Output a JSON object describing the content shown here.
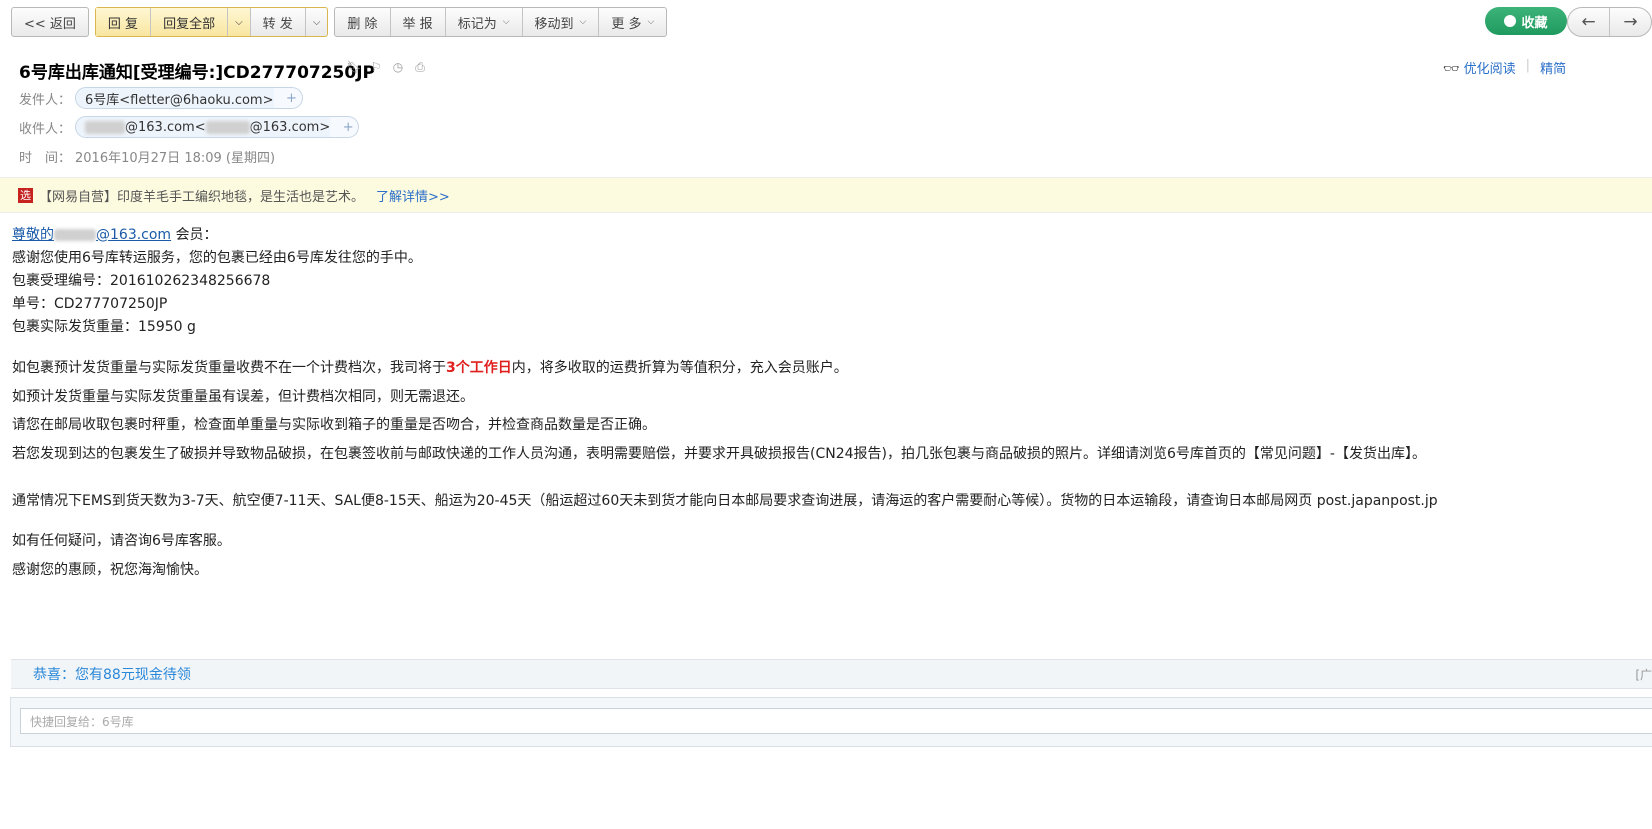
{
  "toolbar": {
    "back": "<< 返回",
    "reply": "回 复",
    "reply_all": "回复全部",
    "forward": "转 发",
    "delete": "删 除",
    "report": "举 报",
    "mark_as": "标记为",
    "move_to": "移动到",
    "more": "更 多"
  },
  "actions": {
    "favorite": "收藏"
  },
  "read_tools": {
    "optimize": "优化阅读",
    "simplified": "精简"
  },
  "mail": {
    "subject": "6号库出库通知[受理编号:]CD277707250JP",
    "from_label": "发件人：",
    "from_value": "6号库<fletter@6haoku.com>",
    "to_label": "收件人：",
    "to_domain1": "@163.com<",
    "to_domain2": "@163.com>",
    "time_label": "时　间：",
    "time_value": "2016年10月27日 18:09 (星期四)"
  },
  "ad": {
    "tag": "选",
    "text": "【网易自营】印度羊毛手工编织地毯，是生活也是艺术。",
    "link": "了解详情>>"
  },
  "body": {
    "greet_prefix": "尊敬的",
    "greet_domain": "@163.com",
    "greet_suffix": " 会员：",
    "line1": "感谢您使用6号库转运服务，您的包裹已经由6号库发往您的手中。",
    "line2": "包裹受理编号：201610262348256678",
    "line3": "单号：CD277707250JP",
    "line4": "包裹实际发货重量：15950 g",
    "p1_a": "如包裹预计发货重量与实际发货重量收费不在一个计费档次，我司将于",
    "p1_red": "3个工作日",
    "p1_b": "内，将多收取的运费折算为等值积分，充入会员账户。",
    "p2": "如预计发货重量与实际发货重量虽有误差，但计费档次相同，则无需退还。",
    "p3": "请您在邮局收取包裹时秤重，检查面单重量与实际收到箱子的重量是否吻合，并检查商品数量是否正确。",
    "p4": "若您发现到达的包裹发生了破损并导致物品破损，在包裹签收前与邮政快递的工作人员沟通，表明需要赔偿，并要求开具破损报告(CN24报告)，拍几张包裹与商品破损的照片。详细请浏览6号库首页的【常见问题】-【发货出库】。",
    "p5": "通常情况下EMS到货天数为3-7天、航空便7-11天、SAL便8-15天、船运为20-45天（船运超过60天未到货才能向日本邮局要求查询进展，请海运的客户需要耐心等候）。货物的日本运输段，请查询日本邮局网页 post.japanpost.jp",
    "p6": "如有任何疑问，请咨询6号库客服。",
    "p7": "感谢您的惠顾，祝您海淘愉快。"
  },
  "promo": {
    "text": "恭喜：您有88元现金待领",
    "right": "[广"
  },
  "reply": {
    "placeholder": "快捷回复给：6号库"
  }
}
